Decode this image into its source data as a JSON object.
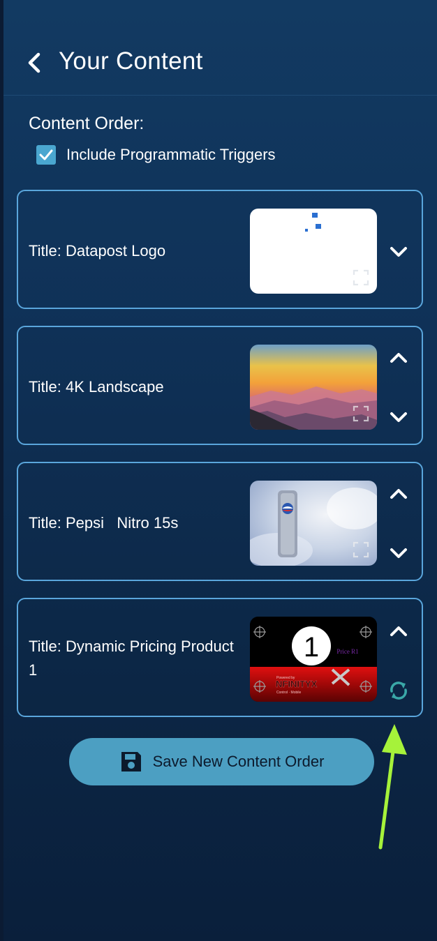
{
  "header": {
    "title": "Your Content",
    "back_icon": "chevron-left-icon"
  },
  "content_order": {
    "label": "Content Order:",
    "include_programmatic": {
      "label": "Include Programmatic Triggers",
      "checked": true
    }
  },
  "items": [
    {
      "title": "Title: Datapost Logo",
      "thumb": "datapost-logo-thumbnail",
      "controls": [
        "chevron-down-icon"
      ]
    },
    {
      "title": "Title: 4K Landscape",
      "thumb": "landscape-thumbnail",
      "controls": [
        "chevron-up-icon",
        "chevron-down-icon"
      ]
    },
    {
      "title": "Title: Pepsi   Nitro 15s",
      "thumb": "pepsi-nitro-thumbnail",
      "controls": [
        "chevron-up-icon",
        "chevron-down-icon"
      ]
    },
    {
      "title": "Title: Dynamic Pricing Product 1",
      "thumb": "dynamic-pricing-thumbnail",
      "controls": [
        "chevron-up-icon",
        "refresh-icon"
      ],
      "thumb_text": {
        "number": "1",
        "price": "Price R1",
        "brand": "NFINITYX",
        "powered_by": "Powered by",
        "tagline": "Control · Mobile"
      }
    }
  ],
  "save_button": {
    "label": "Save New Content Order",
    "icon": "floppy-disk-icon"
  },
  "colors": {
    "panel_top": "#123a62",
    "panel_bottom": "#0a1f3b",
    "card_border": "#5aa6dc",
    "checkbox": "#4aa7d0",
    "save_button": "#4c9fc2",
    "refresh_icon": "#3aa8a8",
    "annotation_arrow": "#a6f23a"
  }
}
